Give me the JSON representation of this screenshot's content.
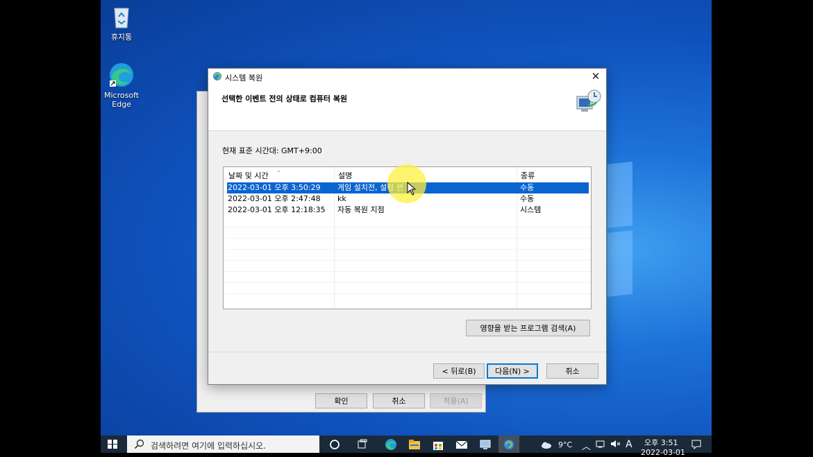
{
  "desktop": {
    "icons": [
      {
        "label": "휴지통",
        "icon": "recycle-bin-icon"
      },
      {
        "label": "Microsoft\nEdge",
        "label_line1": "Microsoft",
        "label_line2": "Edge",
        "icon": "edge-icon"
      }
    ]
  },
  "back_dialog": {
    "ok_label": "확인",
    "cancel_label": "취소",
    "apply_label": "적용(A)"
  },
  "dialog": {
    "title": "시스템 복원",
    "header_title": "선택한 이벤트 전의 상태로 컴퓨터 복원",
    "timezone": "현재 표준 시간대: GMT+9:00",
    "columns": [
      "날짜 및 시간",
      "설명",
      "종류"
    ],
    "rows": [
      {
        "date": "2022-03-01 오후 3:50:29",
        "description": "게임 설치전, 설정 변",
        "type": "수동",
        "selected": true
      },
      {
        "date": "2022-03-01 오후 2:47:48",
        "description": "kk",
        "type": "수동",
        "selected": false
      },
      {
        "date": "2022-03-01 오후 12:18:35",
        "description": "자동 복원 지점",
        "type": "시스템",
        "selected": false
      }
    ],
    "scan_button": "영향을 받는 프로그램 검색(A)",
    "back_button": "< 뒤로(B)",
    "next_button": "다음(N) >",
    "cancel_button": "취소"
  },
  "taskbar": {
    "search_placeholder": "검색하려면 여기에 입력하십시오.",
    "weather": "9°C",
    "ime": "A",
    "time": "오후 3:51",
    "date": "2022-03-01"
  },
  "colors": {
    "selection": "#0a64d0",
    "accent": "#0078d7",
    "taskbar": "#1b2a3a"
  }
}
